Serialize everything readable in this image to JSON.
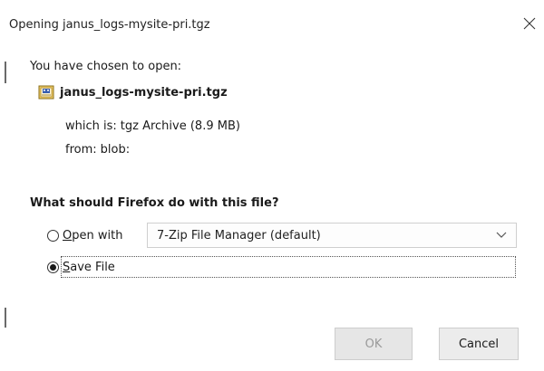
{
  "window": {
    "title": "Opening janus_logs-mysite-pri.tgz",
    "close_icon": "close-icon"
  },
  "info": {
    "chosen_label": "You have chosen to open:",
    "file_name": "janus_logs-mysite-pri.tgz",
    "file_icon": "archive-file-icon",
    "which_is_label": "which is:",
    "which_is_value": "tgz Archive (8.9 MB)",
    "from_label": "from:",
    "from_value": "blob:"
  },
  "action": {
    "question": "What should Firefox do with this file?",
    "open_with": {
      "mnemonic": "O",
      "rest": "pen with",
      "selected": false
    },
    "open_with_app": "7-Zip File Manager (default)",
    "save_file": {
      "mnemonic": "S",
      "rest": "ave File",
      "selected": true
    }
  },
  "buttons": {
    "ok": "OK",
    "cancel": "Cancel"
  },
  "colors": {
    "disabled_text": "#9a9a9a",
    "button_bg": "#ececec",
    "border": "#cdcdcd"
  }
}
